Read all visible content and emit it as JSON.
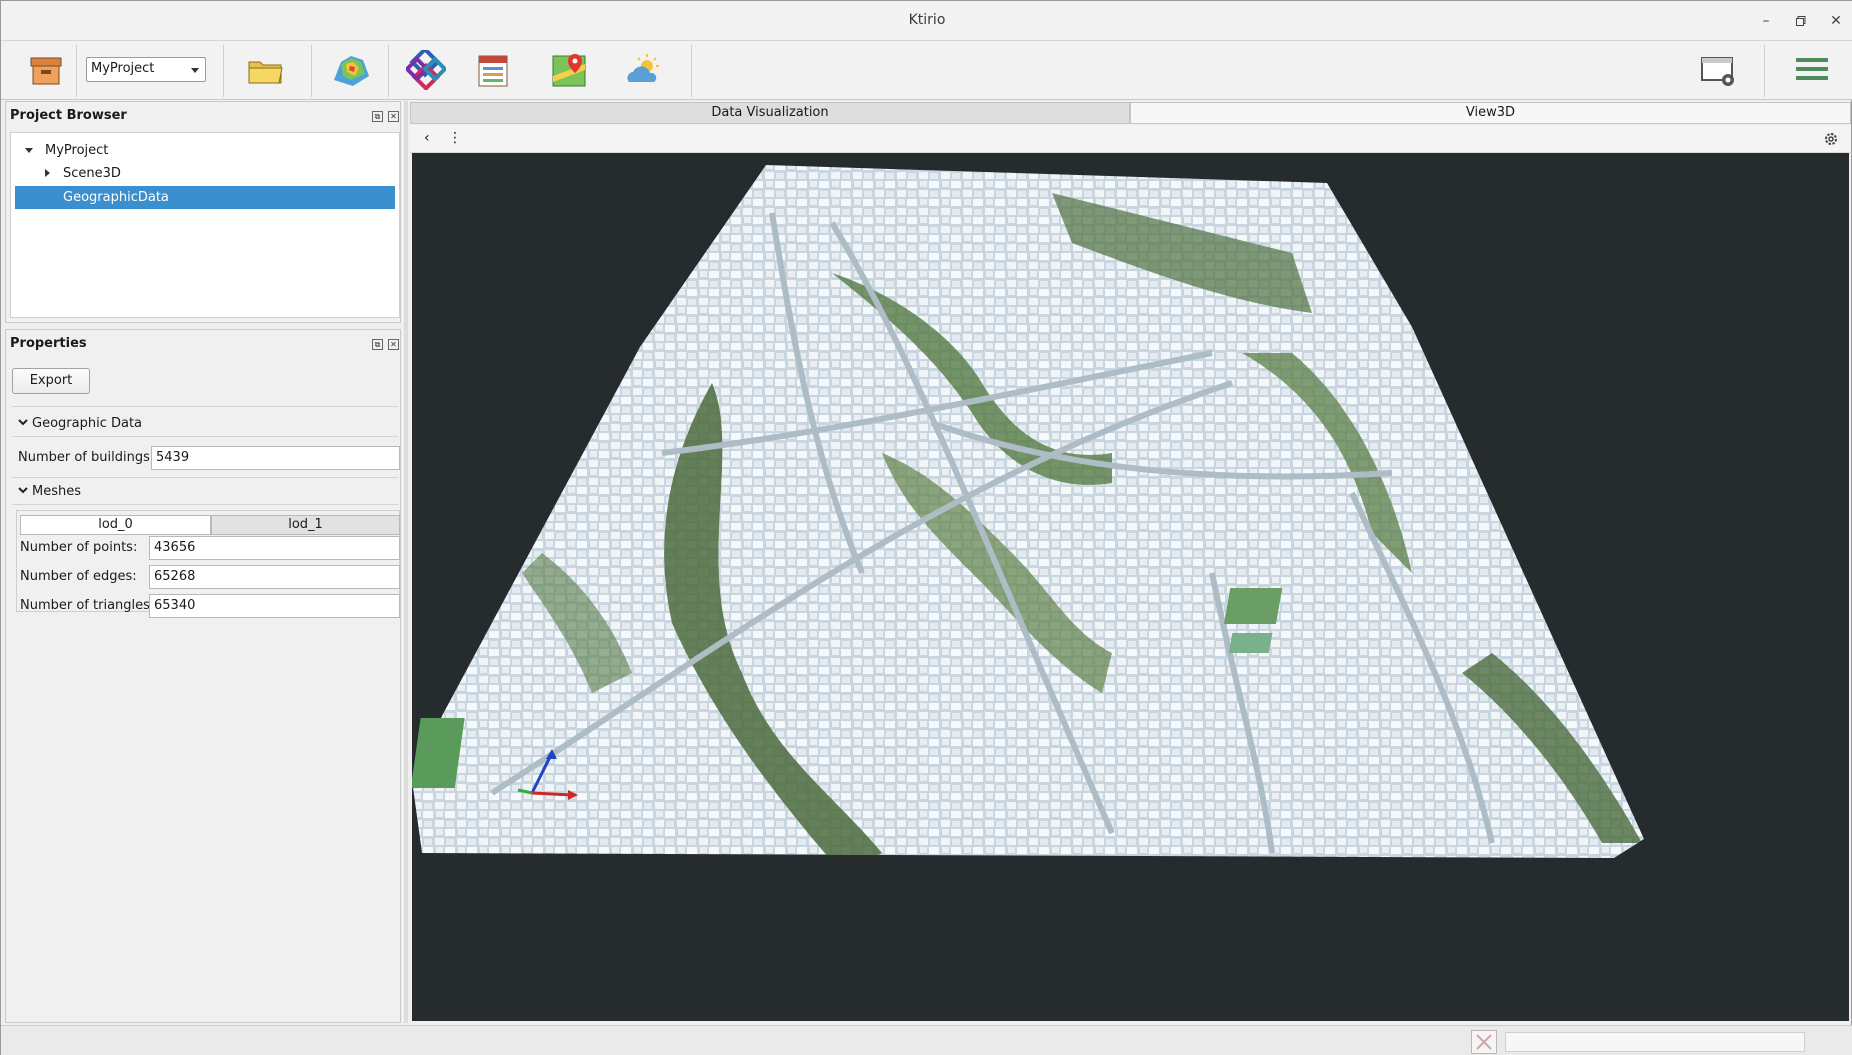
{
  "window": {
    "title": "Ktirio"
  },
  "toolbar": {
    "project_select": "MyProject",
    "icons": [
      "archive-icon",
      "open-folder-icon",
      "terrain-heatmap-icon",
      "ifc-icon",
      "calendar-table-icon",
      "map-pin-icon",
      "weather-icon",
      "window-settings-icon",
      "hamburger-menu-icon"
    ]
  },
  "project_browser": {
    "title": "Project Browser",
    "tree": [
      {
        "label": "MyProject",
        "level": 0,
        "expanded": true
      },
      {
        "label": "Scene3D",
        "level": 1,
        "expanded": false
      },
      {
        "label": "GeographicData",
        "level": 1,
        "selected": true
      }
    ]
  },
  "properties": {
    "title": "Properties",
    "export_label": "Export",
    "geographic_section": "Geographic Data",
    "buildings_label": "Number of buildings:",
    "buildings_value": "5439",
    "meshes_section": "Meshes",
    "mesh_tabs": [
      "lod_0",
      "lod_1"
    ],
    "points_label": "Number of points:",
    "points_value": "43656",
    "edges_label": "Number of edges:",
    "edges_value": "65268",
    "triangles_label": "Number of triangles:",
    "triangles_value": "65340"
  },
  "view": {
    "tabs": [
      "Data Visualization",
      "View3D"
    ],
    "active_tab": "View3D"
  },
  "colors": {
    "accent": "#3a8fce",
    "viewport_bg": "#262b2e",
    "vegetation": "#4b6b3d",
    "buildings": "#e8eef3"
  }
}
